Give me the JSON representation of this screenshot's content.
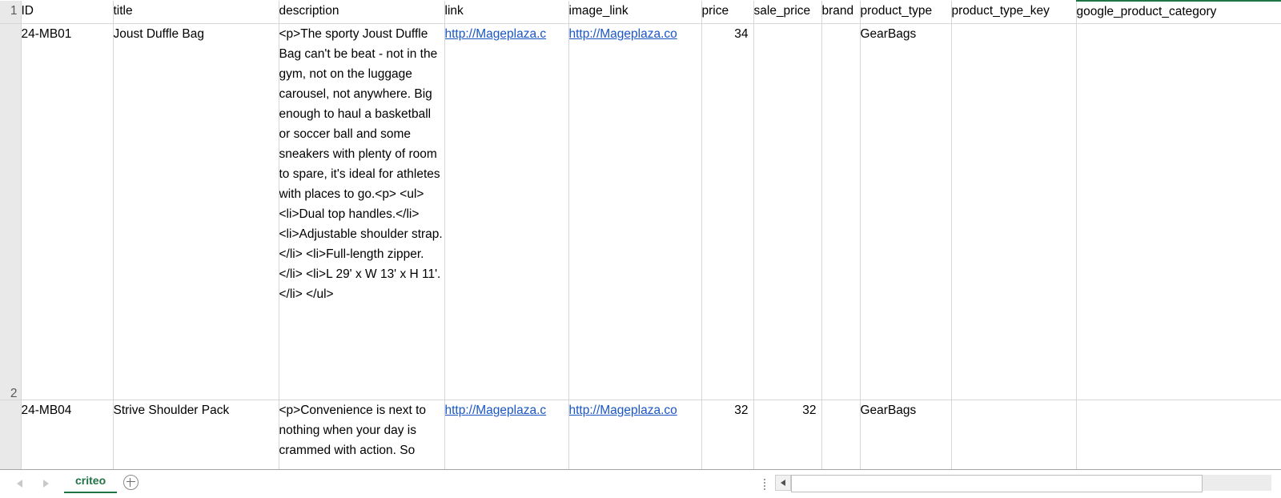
{
  "app": {
    "name": "spreadsheet"
  },
  "grid": {
    "row_numbers": [
      "1",
      "2"
    ],
    "columns": [
      "ID",
      "title",
      "description",
      "link",
      "image_link",
      "price",
      "sale_price",
      "brand",
      "product_type",
      "product_type_key",
      "google_product_category"
    ],
    "selected_column": "google_product_category",
    "selection_color": "#217346",
    "link_color": "#1a56c4",
    "rows": [
      {
        "ID": "24-MB01",
        "title": "Joust Duffle Bag",
        "description": "<p>The sporty Joust Duffle Bag can't be beat - not in the gym, not on the luggage carousel, not anywhere. Big enough to haul a basketball or soccer ball and some sneakers with plenty of room to spare, it's ideal for athletes with places to go.<p>\n<ul>\n<li>Dual top handles.</li>\n<li>Adjustable shoulder strap.</li>\n<li>Full-length zipper.</li>\n<li>L 29' x W 13' x H 11'.</li>\n</ul>",
        "link": "http://Mageplaza.c",
        "image_link": "http://Mageplaza.co",
        "price": "34",
        "sale_price": "",
        "brand": "",
        "product_type": "GearBags",
        "product_type_key": "",
        "google_product_category": ""
      },
      {
        "ID": "24-MB04",
        "title": "Strive Shoulder Pack",
        "description": "<p>Convenience is next to nothing when your day is crammed with action. So",
        "link": "http://Mageplaza.c",
        "image_link": "http://Mageplaza.co",
        "price": "32",
        "sale_price": "32",
        "brand": "",
        "product_type": "GearBags",
        "product_type_key": "",
        "google_product_category": ""
      }
    ]
  },
  "sheet_bar": {
    "prev_label": "previous-sheet",
    "next_label": "next-sheet",
    "tabs": [
      {
        "label": "criteo",
        "active": true
      }
    ],
    "add_label": "add-sheet"
  },
  "scrollbar": {
    "orientation": "horizontal",
    "left_arrow": "scroll-left"
  }
}
